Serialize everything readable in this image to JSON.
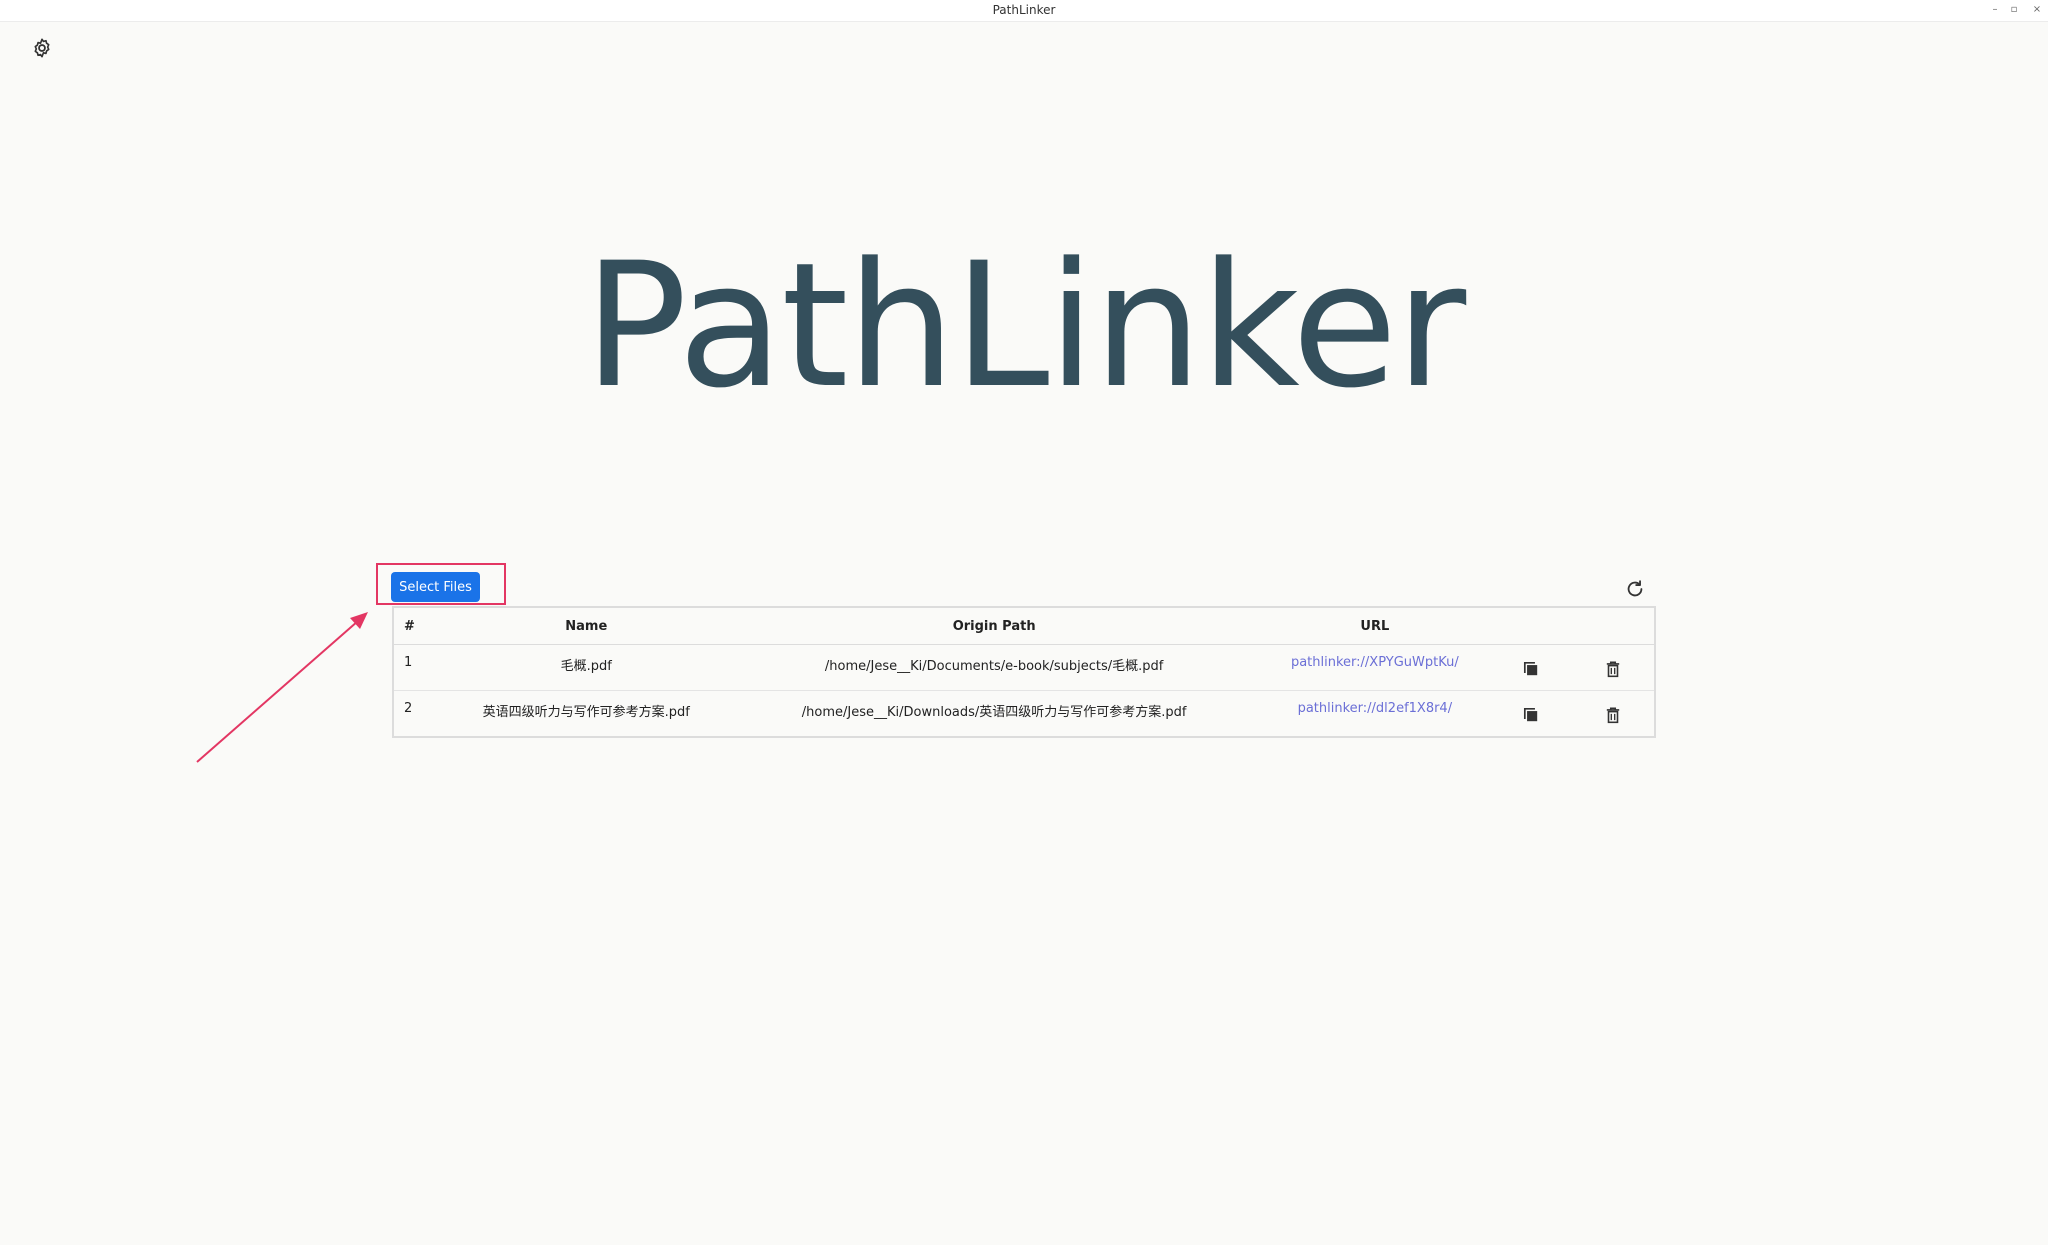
{
  "window": {
    "title": "PathLinker",
    "controls": [
      "minimize",
      "maximize",
      "close"
    ],
    "minimize_glyph": "–",
    "maximize_glyph": "▫",
    "close_glyph": "×"
  },
  "logo_text": "PathLinker",
  "select_files_label": "Select Files",
  "table": {
    "headers": [
      "#",
      "Name",
      "Origin Path",
      "URL"
    ],
    "rows": [
      {
        "index": "1",
        "name": "毛概.pdf",
        "origin_path": "/home/Jese__Ki/Documents/e-book/subjects/毛概.pdf",
        "url": "pathlinker://XPYGuWptKu/"
      },
      {
        "index": "2",
        "name": "英语四级听力与写作可参考方案.pdf",
        "origin_path": "/home/Jese__Ki/Downloads/英语四级听力与写作可参考方案.pdf",
        "url": "pathlinker://dl2ef1X8r4/"
      }
    ]
  },
  "colors": {
    "accent": "#1a73e8",
    "logo": "#344f5c",
    "link": "#6b6fd6",
    "annotation": "#e33663",
    "background": "#fafaf8"
  },
  "icons": [
    "settings-gear-icon",
    "refresh-icon",
    "copy-icon",
    "trash-icon"
  ]
}
